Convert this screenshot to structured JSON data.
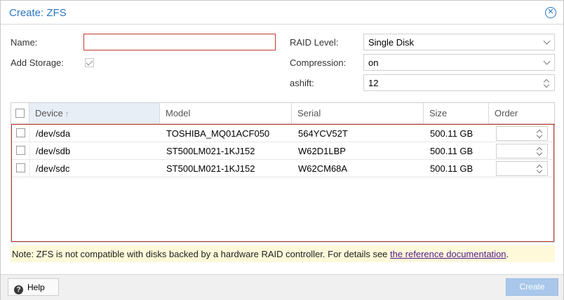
{
  "dialog": {
    "title": "Create: ZFS",
    "close_icon": "close-circle-icon"
  },
  "form": {
    "name_label": "Name:",
    "name_value": "",
    "add_storage_label": "Add Storage:",
    "add_storage_checked": true,
    "raid_label": "RAID Level:",
    "raid_value": "Single Disk",
    "compression_label": "Compression:",
    "compression_value": "on",
    "ashift_label": "ashift:",
    "ashift_value": "12"
  },
  "grid": {
    "columns": [
      "Device",
      "Model",
      "Serial",
      "Size",
      "Order"
    ],
    "sorted_column": "Device",
    "sort_direction": "ascending",
    "rows": [
      {
        "device": "/dev/sda",
        "model": "TOSHIBA_MQ01ACF050",
        "serial": "564YCV52T",
        "size": "500.11 GB",
        "order": ""
      },
      {
        "device": "/dev/sdb",
        "model": "ST500LM021-1KJ152",
        "serial": "W62D1LBP",
        "size": "500.11 GB",
        "order": ""
      },
      {
        "device": "/dev/sdc",
        "model": "ST500LM021-1KJ152",
        "serial": "W62CM68A",
        "size": "500.11 GB",
        "order": ""
      }
    ]
  },
  "note": {
    "text": "Note: ZFS is not compatible with disks backed by a hardware RAID controller. For details see ",
    "link": "the reference documentation",
    "suffix": "."
  },
  "footer": {
    "help_label": "Help",
    "create_label": "Create"
  },
  "colors": {
    "accent": "#2a76c6",
    "invalid_border": "#c0392b",
    "note_bg": "#fdf9d9",
    "create_disabled": "#a8c7ea"
  }
}
